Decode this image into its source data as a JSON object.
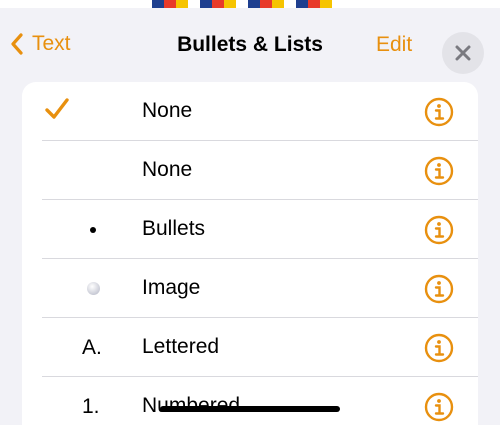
{
  "colors": {
    "accent": "#e8900f",
    "sheet_bg": "#f2f2f7",
    "list_bg": "#ffffff"
  },
  "nav": {
    "back_label": "Text",
    "title": "Bullets & Lists",
    "edit_label": "Edit"
  },
  "list": {
    "items": [
      {
        "label": "None",
        "marker": "",
        "marker_type": "none",
        "selected": true
      },
      {
        "label": "None",
        "marker": "",
        "marker_type": "none",
        "selected": false
      },
      {
        "label": "Bullets",
        "marker": "",
        "marker_type": "bullet",
        "selected": false
      },
      {
        "label": "Image",
        "marker": "",
        "marker_type": "image-bullet",
        "selected": false
      },
      {
        "label": "Lettered",
        "marker": "A.",
        "marker_type": "text",
        "selected": false
      },
      {
        "label": "Numbered",
        "marker": "1.",
        "marker_type": "text",
        "selected": false
      }
    ]
  }
}
